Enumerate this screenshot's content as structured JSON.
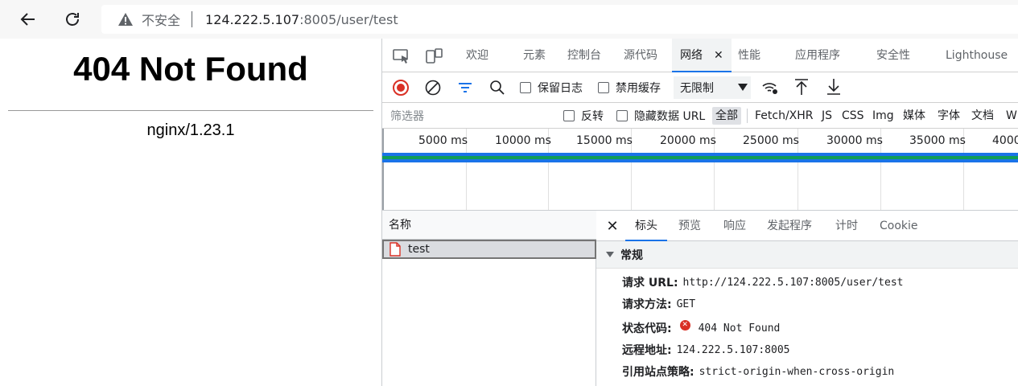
{
  "browser": {
    "security_label": "不安全",
    "url_host": "124.222.5.107",
    "url_rest": ":8005/user/test",
    "icons": {
      "back": "back-arrow-icon",
      "reload": "reload-icon",
      "warning": "warning-icon"
    }
  },
  "page": {
    "title": "404 Not Found",
    "server": "nginx/1.23.1"
  },
  "devtools": {
    "tabs": [
      "欢迎",
      "元素",
      "控制台",
      "源代码",
      "网络",
      "性能",
      "应用程序",
      "安全性",
      "Lighthouse"
    ],
    "active_tab": "网络",
    "controls": {
      "preserve_log": "保留日志",
      "disable_cache": "禁用缓存",
      "throttling": "无限制"
    },
    "filter": {
      "placeholder": "筛选器",
      "invert": "反转",
      "hide_data_urls": "隐藏数据 URL",
      "types": [
        "全部",
        "Fetch/XHR",
        "JS",
        "CSS",
        "Img",
        "媒体",
        "字体",
        "文档",
        "W"
      ]
    },
    "timeline_ticks": [
      "5000 ms",
      "10000 ms",
      "15000 ms",
      "20000 ms",
      "25000 ms",
      "30000 ms",
      "35000 ms",
      "4000"
    ],
    "requests": {
      "header": "名称",
      "rows": [
        "test"
      ]
    },
    "details": {
      "tabs": [
        "标头",
        "预览",
        "响应",
        "发起程序",
        "计时",
        "Cookie"
      ],
      "section": "常规",
      "general": {
        "url_key": "请求 URL:",
        "url_val": "http://124.222.5.107:8005/user/test",
        "method_key": "请求方法:",
        "method_val": "GET",
        "status_key": "状态代码:",
        "status_val": "404 Not Found",
        "remote_key": "远程地址:",
        "remote_val": "124.222.5.107:8005",
        "referrer_key": "引用站点策略:",
        "referrer_val": "strict-origin-when-cross-origin"
      }
    },
    "colors": {
      "accent": "#1a73e8",
      "error": "#d93025",
      "record": "#d93025"
    }
  }
}
